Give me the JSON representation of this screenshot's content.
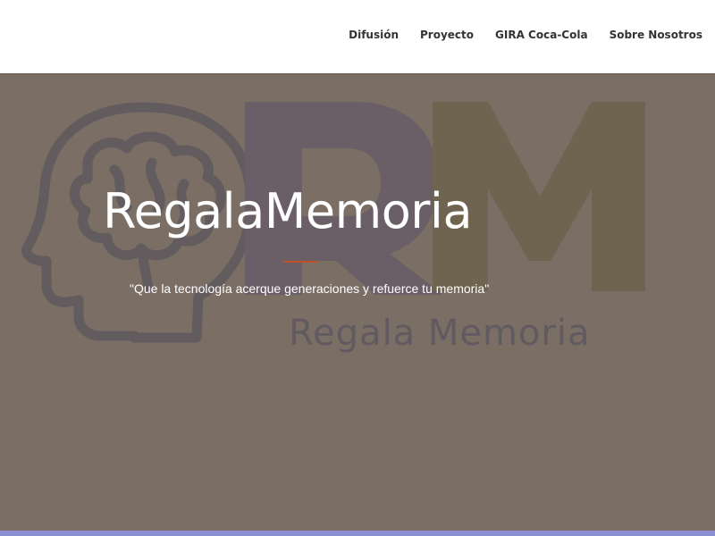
{
  "nav": {
    "items": [
      {
        "label": "Difusión"
      },
      {
        "label": "Proyecto"
      },
      {
        "label": "GIRA Coca-Cola"
      },
      {
        "label": "Sobre Nosotros"
      }
    ]
  },
  "hero": {
    "title": "RegalaMemoria",
    "tagline": "\"Que la tecnología acerque generaciones y refuerce tu memoria\"",
    "background_color": "#7a6e65",
    "divider_color": "#c0502a",
    "logo": {
      "letters": "RM",
      "caption": "Regala Memoria",
      "icon": "brain-head-icon"
    }
  },
  "footer_bar": {
    "color": "#8b8fd6"
  }
}
